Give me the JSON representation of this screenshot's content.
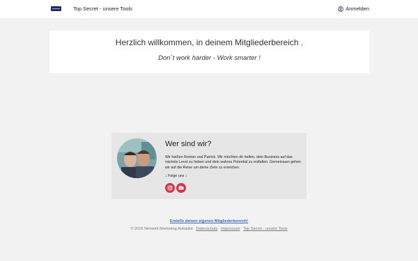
{
  "header": {
    "title": "Top Secret - unsere Tools",
    "login_label": "Anmelden"
  },
  "welcome": {
    "heading": "Herzlich willkommen, in deinem Mitgliederbereich .",
    "tagline": "Don´t work harder - Work smarter !"
  },
  "about": {
    "heading": "Wer sind wir?",
    "description": "Wir heißen Roman und Patrick. Wir möchten dir helfen, dein Business auf das nächste Level zu heben und dein wahres Potential zu entfalten. Gemeinsam gehen wir auf die Reise um deine Ziele zu erreichen.",
    "follow": "↓ Folge uns ↓",
    "social": [
      "instagram-icon",
      "youtube-icon"
    ]
  },
  "footer": {
    "cta": "Erstelle deinen eigenen Mitgliederbereich!",
    "copyright": "© 2025 Network Marketing Autopilot",
    "links": [
      "Datenschutz",
      "Impressum",
      "Top Secret - unsere Tools"
    ]
  },
  "colors": {
    "background": "#f2f2f2",
    "card": "#ffffff",
    "about_bg": "#e6e6e6",
    "social": "#d2364b",
    "link": "#3b6bb0"
  }
}
